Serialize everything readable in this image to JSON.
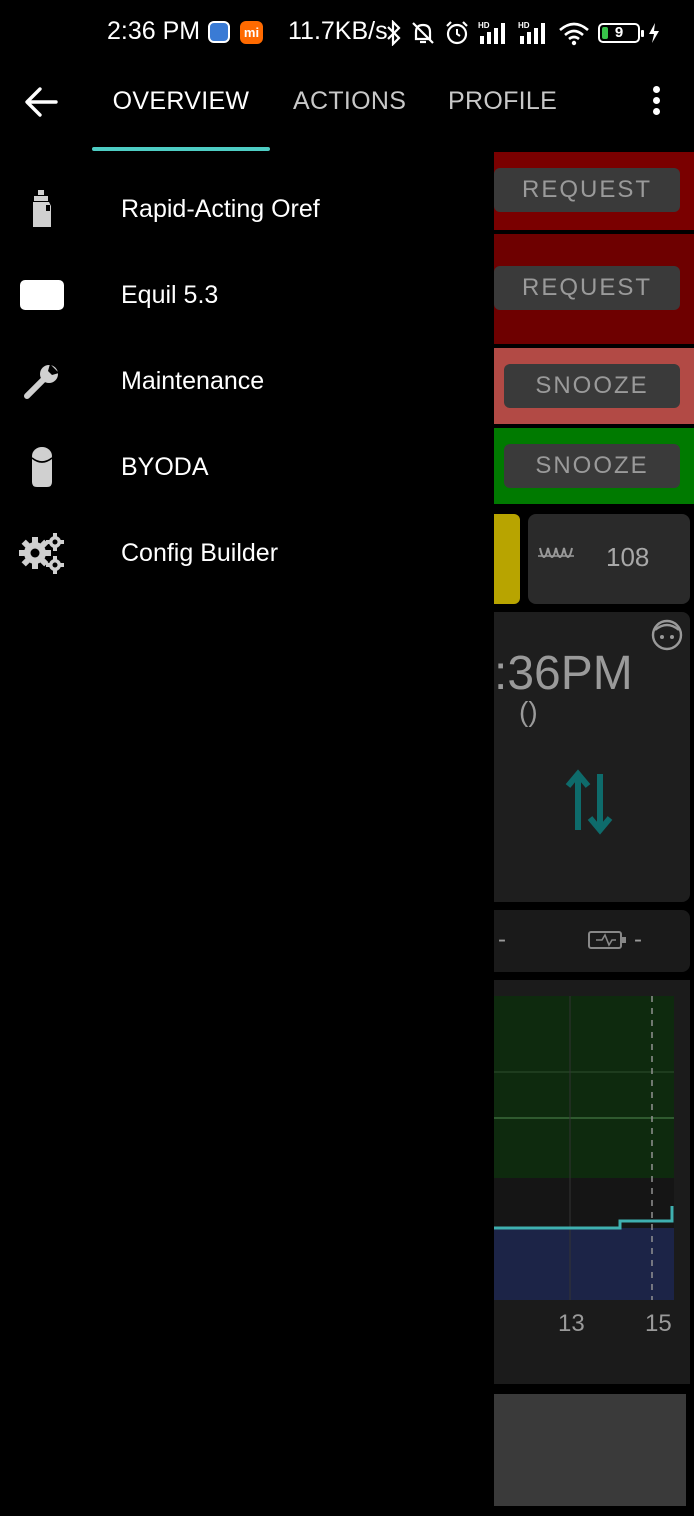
{
  "status_bar": {
    "time": "2:36 PM",
    "network_speed": "11.7KB/s",
    "battery_level": "9",
    "icons": [
      "app-icon",
      "mi-icon",
      "bluetooth-icon",
      "mute-bell-icon",
      "alarm-icon",
      "signal-hd-icon",
      "signal-hd-icon",
      "wifi-icon",
      "battery-icon",
      "charging-icon"
    ],
    "mi_label": "mi"
  },
  "toolbar": {
    "back_icon": "arrow-left-icon",
    "tabs": [
      {
        "label": "OVERVIEW",
        "selected": true
      },
      {
        "label": "ACTIONS",
        "selected": false
      },
      {
        "label": "PROFILE",
        "selected": false
      }
    ],
    "accent_color": "#4ecdc4",
    "menu_icon": "more-vert-icon"
  },
  "drawer": {
    "items": [
      {
        "label": "Rapid-Acting Oref",
        "icon": "insulin-vial-icon"
      },
      {
        "label": "Equil 5.3",
        "icon": "pump-card-icon"
      },
      {
        "label": "Maintenance",
        "icon": "wrench-icon"
      },
      {
        "label": "BYODA",
        "icon": "sensor-icon"
      },
      {
        "label": "Config Builder",
        "icon": "gears-icon"
      }
    ]
  },
  "overview_background": {
    "buttons": [
      "REQUEST",
      "REQUEST",
      "SNOOZE",
      "SNOOZE"
    ],
    "tile_value": "108",
    "time_fragment": ":36PM",
    "delta_fragment": "()",
    "strip_values": [
      "-",
      "-"
    ],
    "chart_ticks": [
      "13",
      "15"
    ],
    "colors": {
      "red_dark": "#7a0000",
      "red_light": "#b24a45",
      "green": "#007a00",
      "yellow": "#b8a400",
      "teal": "#0e6b6b"
    }
  }
}
